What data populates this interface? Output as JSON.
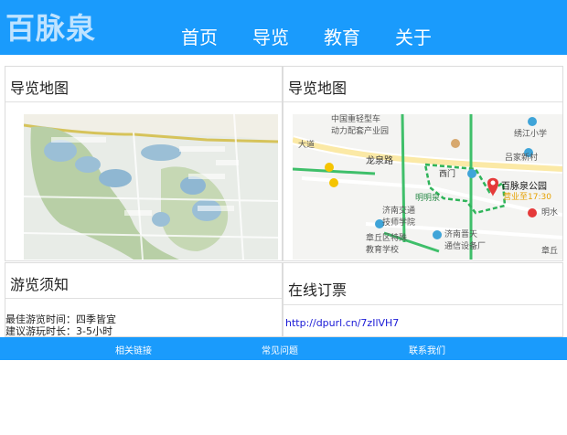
{
  "header": {
    "logo": "百脉泉",
    "nav": [
      "首页",
      "导览",
      "教育",
      "关于"
    ]
  },
  "panels": {
    "map1": {
      "title": "导览地图"
    },
    "map2": {
      "title": "导览地图"
    },
    "notice": {
      "title": "游览须知",
      "line1": "最佳游览时间：四季皆宜",
      "line2": "建议游玩时长：3-5小时"
    },
    "ticket": {
      "title": "在线订票",
      "url": "http://dpurl.cn/7zIlVH7"
    }
  },
  "map2_labels": {
    "factory1": "中国重轻型车",
    "factory2": "动力配套产业园",
    "school1": "绣江小学",
    "road1": "龙泉路",
    "village": "吕家新村",
    "gate": "西门",
    "spring": "明明泉",
    "park": "百脉泉公园",
    "hours": "营业至17:30",
    "school2a": "济南交通",
    "school2b": "技师学院",
    "school3a": "章丘区特殊",
    "school3b": "教育学校",
    "telecom_a": "济南晋天",
    "telecom_b": "通信设备厂",
    "mingshui": "明水",
    "zhangqiu": "章丘",
    "dazhu": "大道"
  },
  "footer": {
    "links": [
      "相关链接",
      "常见问题",
      "联系我们"
    ]
  },
  "colors": {
    "brand_blue": "#1a9bfc",
    "logo_text": "#bfe3ff",
    "route_green": "#2fb45a",
    "marker_red": "#e53a3a"
  }
}
